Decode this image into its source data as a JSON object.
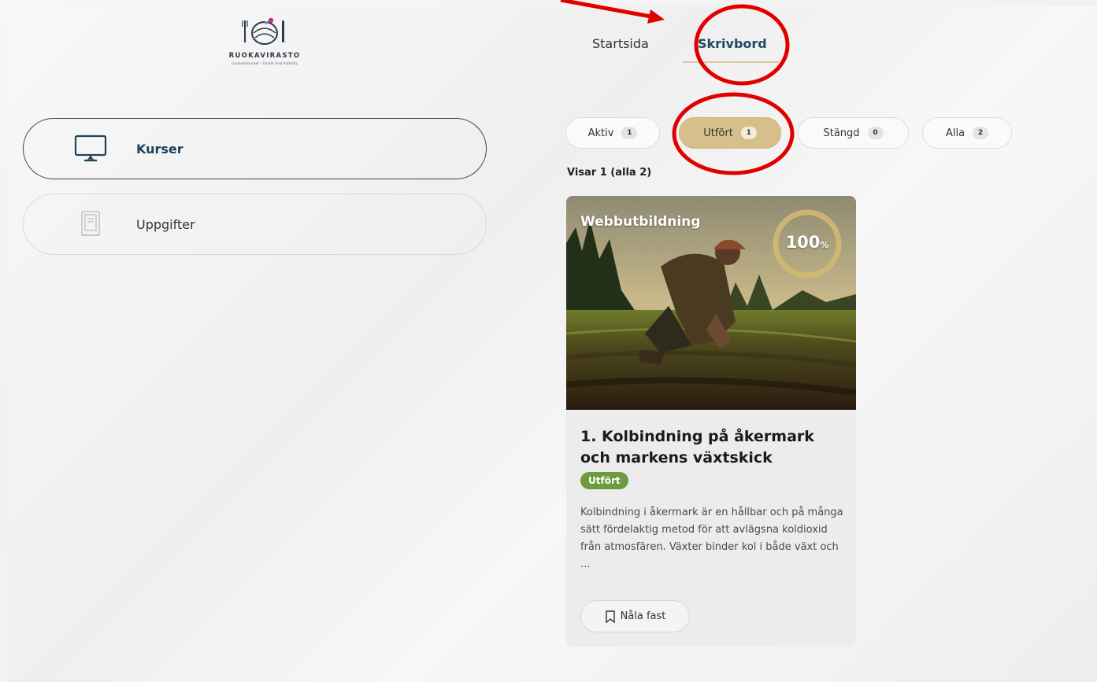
{
  "logo": {
    "name": "RUOKAVIRASTO",
    "subtitle": "Livsmedelsverket • Finnish Food Authority"
  },
  "sidebar": {
    "items": [
      {
        "label": "Kurser",
        "icon": "monitor-icon",
        "active": true
      },
      {
        "label": "Uppgifter",
        "icon": "notebook-icon",
        "active": false
      }
    ]
  },
  "tabs": [
    {
      "label": "Startsida",
      "active": false
    },
    {
      "label": "Skrivbord",
      "active": true
    }
  ],
  "filters": [
    {
      "label": "Aktiv",
      "count": "1",
      "selected": false
    },
    {
      "label": "Utfört",
      "count": "1",
      "selected": true
    },
    {
      "label": "Stängd",
      "count": "0",
      "selected": false
    },
    {
      "label": "Alla",
      "count": "2",
      "selected": false
    }
  ],
  "showing": "Visar 1 (alla 2)",
  "course_card": {
    "type_label": "Webbutbildning",
    "progress_value": "100",
    "progress_unit": "%",
    "progress_fraction": 1.0,
    "title": "1. Kolbindning på åkermark och markens växtskick",
    "status": "Utfört",
    "description": "Kolbindning i åkermark är en hållbar och på många sätt fördelaktig metod för att avlägsna koldioxid från atmosfären. Växter binder kol i både växt och ...",
    "pin_label": "Nåla fast"
  },
  "colors": {
    "accent_dark": "#1f4257",
    "filter_selected": "#d6bf8a",
    "status_done": "#6e9a3f",
    "annotation_red": "#e00000"
  }
}
